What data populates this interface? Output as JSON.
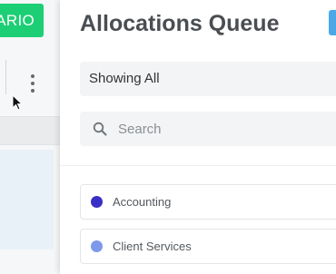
{
  "background_app": {
    "primary_button_label": "ARIO",
    "accent_color": "#1ccf75"
  },
  "drawer": {
    "title": "Allocations Queue",
    "filter": {
      "selected": "Showing All"
    },
    "search": {
      "placeholder": "Search",
      "value": ""
    },
    "departments": [
      {
        "label": "Accounting",
        "color": "#3a2fc4"
      },
      {
        "label": "Client Services",
        "color": "#7e99e9"
      }
    ]
  },
  "icons": [
    "search-icon",
    "kebab-menu-icon",
    "mouse-cursor-icon"
  ]
}
